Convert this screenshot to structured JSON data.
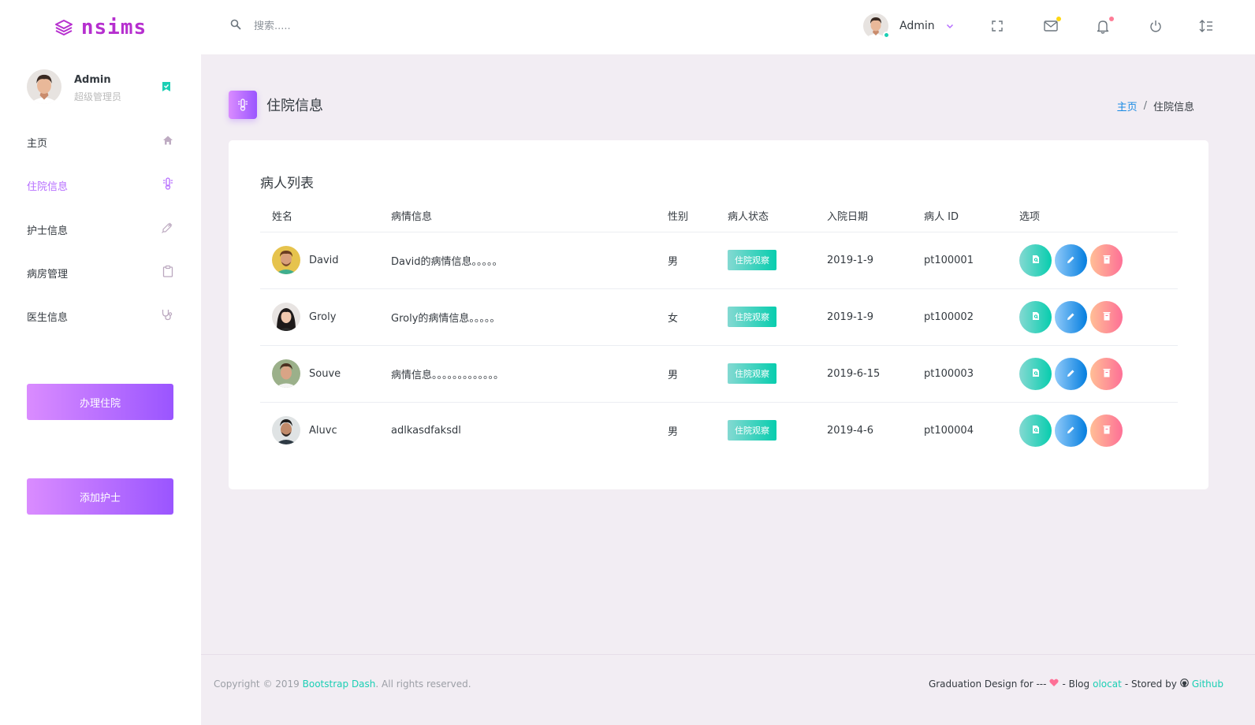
{
  "brand": {
    "name": "nsims"
  },
  "search": {
    "placeholder": "搜索....."
  },
  "navbar": {
    "user_name": "Admin"
  },
  "sidebar": {
    "profile": {
      "name": "Admin",
      "role": "超级管理员"
    },
    "items": [
      {
        "label": "主页",
        "icon": "home-icon"
      },
      {
        "label": "住院信息",
        "icon": "thermometer-icon"
      },
      {
        "label": "护士信息",
        "icon": "syringe-icon"
      },
      {
        "label": "病房管理",
        "icon": "clipboard-icon"
      },
      {
        "label": "医生信息",
        "icon": "stethoscope-icon"
      }
    ],
    "buttons": {
      "admit": "办理住院",
      "add_nurse": "添加护士"
    }
  },
  "page": {
    "title": "住院信息"
  },
  "breadcrumb": {
    "home": "主页",
    "separator": "/",
    "current": "住院信息"
  },
  "card": {
    "title": "病人列表",
    "columns": [
      "姓名",
      "病情信息",
      "性别",
      "病人状态",
      "入院日期",
      "病人 ID",
      "选项"
    ],
    "rows": [
      {
        "name": "David",
        "condition": "David的病情信息。。。。。",
        "gender": "男",
        "status": "住院观察",
        "date": "2019-1-9",
        "id": "pt100001"
      },
      {
        "name": "Groly",
        "condition": "Groly的病情信息。。。。。",
        "gender": "女",
        "status": "住院观察",
        "date": "2019-1-9",
        "id": "pt100002"
      },
      {
        "name": "Souve",
        "condition": "病情信息。。。。。。。。。。。。。",
        "gender": "男",
        "status": "住院观察",
        "date": "2019-6-15",
        "id": "pt100003"
      },
      {
        "name": "Aluvc",
        "condition": "adlkasdfaksdl",
        "gender": "男",
        "status": "住院观察",
        "date": "2019-4-6",
        "id": "pt100004"
      }
    ]
  },
  "footer": {
    "copyright_prefix": "Copyright © 2019",
    "copyright_link": "Bootstrap Dash",
    "copyright_suffix": ". All rights reserved.",
    "graduation": "Graduation Design for ---",
    "blog_label": "- Blog",
    "blog_link": "olocat",
    "stored_label": "- Stored by",
    "github_link": "Github"
  },
  "colors": {
    "accent": "#b66dff",
    "brand": "#b62fcf",
    "teal": "#1bcfb4",
    "blue": "#198ae3",
    "danger": "#fe7096"
  }
}
